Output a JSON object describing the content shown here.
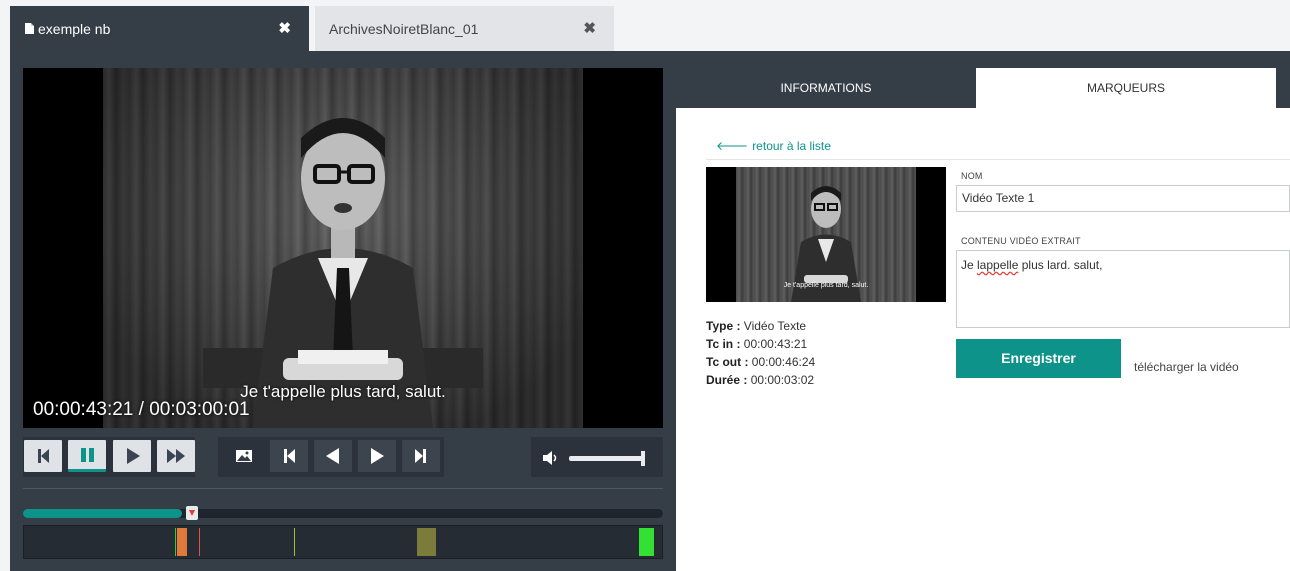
{
  "tabs": [
    {
      "label": "exemple nb",
      "icon": "document-icon",
      "active": true
    },
    {
      "label": "ArchivesNoiretBlanc_01",
      "active": false
    }
  ],
  "player": {
    "subtitle": "Je t'appelle plus tard, salut.",
    "timecode": "00:00:43:21 / 00:03:00:01",
    "progress_fraction": 0.248,
    "volume_fraction": 1.0
  },
  "controls": {
    "group1": [
      "skip-start-icon",
      "pause-icon",
      "play-icon",
      "fast-forward-icon"
    ],
    "group2": [
      "image-icon",
      "previous-marker-icon",
      "step-back-icon",
      "step-forward-icon",
      "next-marker-icon"
    ],
    "volume_icon": "speaker-icon"
  },
  "timeline_markers": [
    {
      "color": "#2ecc40",
      "position": 0.237
    },
    {
      "color": "#e07a3b",
      "position": 0.247
    },
    {
      "color": "#d9534f",
      "position": 0.275
    },
    {
      "color": "#9fc22d",
      "position": 0.423
    },
    {
      "color": "#7c7c3a",
      "position": 0.631
    },
    {
      "color": "#d9534f",
      "position": 0.972
    },
    {
      "color": "#33e033",
      "position": 0.976
    }
  ],
  "right_tabs": [
    {
      "label": "INFORMATIONS",
      "active": false
    },
    {
      "label": "MARQUEURS",
      "active": true
    }
  ],
  "marker_detail": {
    "back_link": "retour à la liste",
    "thumbnail_subtitle": "Je t'appelle plus tard, salut.",
    "type_label": "Type :",
    "type_value": "Vidéo Texte",
    "tc_in_label": "Tc in :",
    "tc_in_value": "00:00:43:21",
    "tc_out_label": "Tc out :",
    "tc_out_value": "00:00:46:24",
    "duree_label": "Durée :",
    "duree_value": "00:00:03:02",
    "nom_label": "NOM",
    "nom_value": "Vidéo Texte 1",
    "contenu_label": "CONTENU VIDÉO EXTRAIT",
    "contenu_misspelled": "lappelle",
    "contenu_before": "Je ",
    "contenu_after": " plus lard. salut,",
    "save_label": "Enregistrer",
    "download_label": "télécharger la vidéo"
  },
  "colors": {
    "accent": "#0e938a",
    "panel_dark": "#353d47"
  }
}
